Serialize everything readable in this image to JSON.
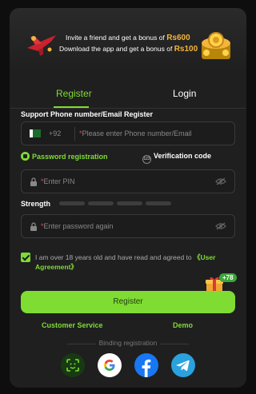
{
  "banner": {
    "line1_prefix": "Invite a friend and get a bonus of",
    "line1_amount": "Rs600",
    "line2_prefix": "Download the app and get a bonus of",
    "line2_amount": "Rs100"
  },
  "tabs": {
    "register": "Register",
    "login": "Login"
  },
  "form": {
    "support_label": "Support Phone number/Email Register",
    "country_code": "+92",
    "phone_placeholder": "Please enter Phone number/Email",
    "mode_password": "Password registration",
    "mode_verification": "Verification code",
    "mode_verification_icon_text": "123",
    "pin_placeholder": "Enter PIN",
    "strength_label": "Strength",
    "confirm_placeholder": "Enter password again",
    "required_mark": "*",
    "agreement_text": "I am over 18 years old and have read and agreed to",
    "agreement_link": "《User Agreement》",
    "gift_badge": "+78",
    "register_button": "Register"
  },
  "links": {
    "customer_service": "Customer Service",
    "demo": "Demo"
  },
  "binding": {
    "label": "Binding registration"
  },
  "social": [
    "face-icon",
    "google-icon",
    "facebook-icon",
    "telegram-icon"
  ],
  "colors": {
    "accent": "#7fdc33",
    "amount": "#f4b53a",
    "panel": "#1f1f1f"
  }
}
